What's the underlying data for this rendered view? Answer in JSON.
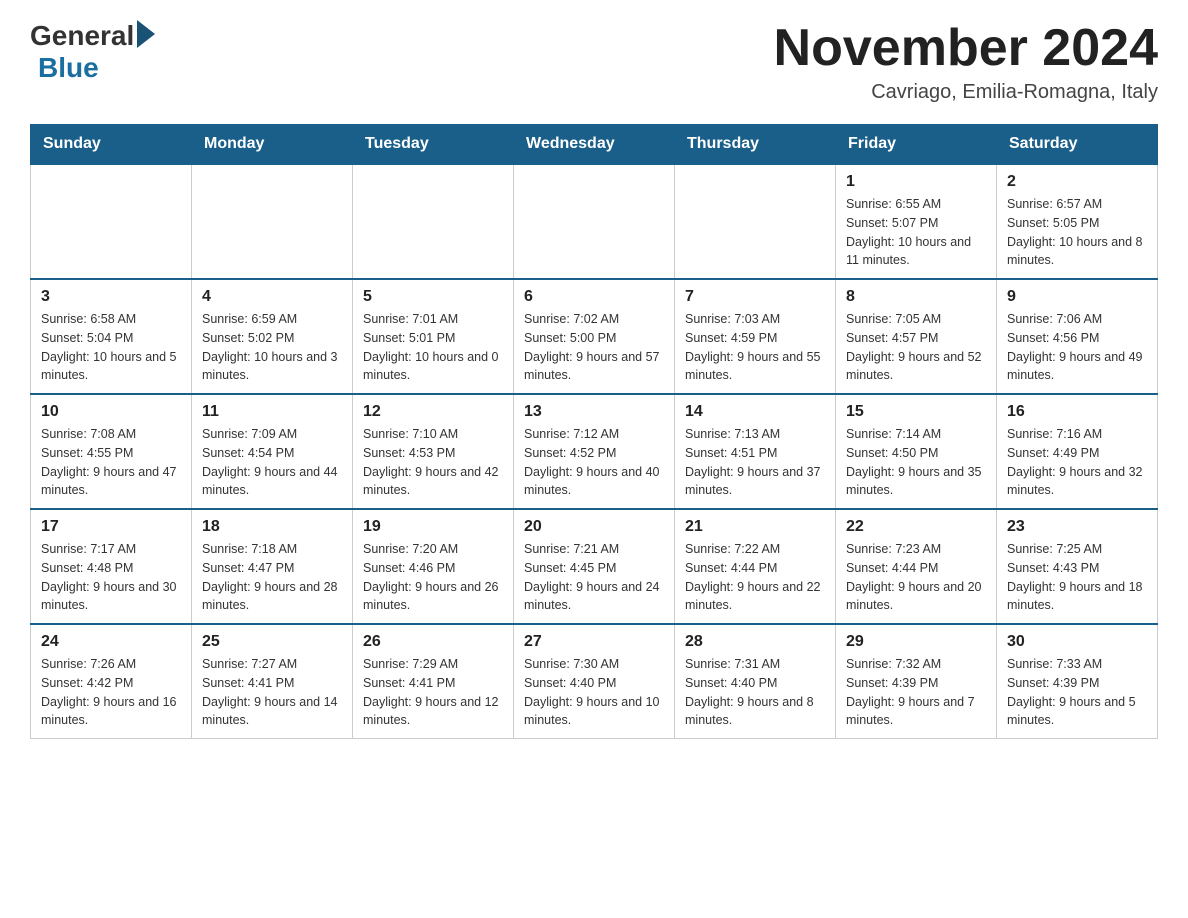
{
  "logo": {
    "general": "General",
    "blue": "Blue"
  },
  "title": "November 2024",
  "location": "Cavriago, Emilia-Romagna, Italy",
  "days_of_week": [
    "Sunday",
    "Monday",
    "Tuesday",
    "Wednesday",
    "Thursday",
    "Friday",
    "Saturday"
  ],
  "weeks": [
    [
      {
        "day": "",
        "info": ""
      },
      {
        "day": "",
        "info": ""
      },
      {
        "day": "",
        "info": ""
      },
      {
        "day": "",
        "info": ""
      },
      {
        "day": "",
        "info": ""
      },
      {
        "day": "1",
        "info": "Sunrise: 6:55 AM\nSunset: 5:07 PM\nDaylight: 10 hours and 11 minutes."
      },
      {
        "day": "2",
        "info": "Sunrise: 6:57 AM\nSunset: 5:05 PM\nDaylight: 10 hours and 8 minutes."
      }
    ],
    [
      {
        "day": "3",
        "info": "Sunrise: 6:58 AM\nSunset: 5:04 PM\nDaylight: 10 hours and 5 minutes."
      },
      {
        "day": "4",
        "info": "Sunrise: 6:59 AM\nSunset: 5:02 PM\nDaylight: 10 hours and 3 minutes."
      },
      {
        "day": "5",
        "info": "Sunrise: 7:01 AM\nSunset: 5:01 PM\nDaylight: 10 hours and 0 minutes."
      },
      {
        "day": "6",
        "info": "Sunrise: 7:02 AM\nSunset: 5:00 PM\nDaylight: 9 hours and 57 minutes."
      },
      {
        "day": "7",
        "info": "Sunrise: 7:03 AM\nSunset: 4:59 PM\nDaylight: 9 hours and 55 minutes."
      },
      {
        "day": "8",
        "info": "Sunrise: 7:05 AM\nSunset: 4:57 PM\nDaylight: 9 hours and 52 minutes."
      },
      {
        "day": "9",
        "info": "Sunrise: 7:06 AM\nSunset: 4:56 PM\nDaylight: 9 hours and 49 minutes."
      }
    ],
    [
      {
        "day": "10",
        "info": "Sunrise: 7:08 AM\nSunset: 4:55 PM\nDaylight: 9 hours and 47 minutes."
      },
      {
        "day": "11",
        "info": "Sunrise: 7:09 AM\nSunset: 4:54 PM\nDaylight: 9 hours and 44 minutes."
      },
      {
        "day": "12",
        "info": "Sunrise: 7:10 AM\nSunset: 4:53 PM\nDaylight: 9 hours and 42 minutes."
      },
      {
        "day": "13",
        "info": "Sunrise: 7:12 AM\nSunset: 4:52 PM\nDaylight: 9 hours and 40 minutes."
      },
      {
        "day": "14",
        "info": "Sunrise: 7:13 AM\nSunset: 4:51 PM\nDaylight: 9 hours and 37 minutes."
      },
      {
        "day": "15",
        "info": "Sunrise: 7:14 AM\nSunset: 4:50 PM\nDaylight: 9 hours and 35 minutes."
      },
      {
        "day": "16",
        "info": "Sunrise: 7:16 AM\nSunset: 4:49 PM\nDaylight: 9 hours and 32 minutes."
      }
    ],
    [
      {
        "day": "17",
        "info": "Sunrise: 7:17 AM\nSunset: 4:48 PM\nDaylight: 9 hours and 30 minutes."
      },
      {
        "day": "18",
        "info": "Sunrise: 7:18 AM\nSunset: 4:47 PM\nDaylight: 9 hours and 28 minutes."
      },
      {
        "day": "19",
        "info": "Sunrise: 7:20 AM\nSunset: 4:46 PM\nDaylight: 9 hours and 26 minutes."
      },
      {
        "day": "20",
        "info": "Sunrise: 7:21 AM\nSunset: 4:45 PM\nDaylight: 9 hours and 24 minutes."
      },
      {
        "day": "21",
        "info": "Sunrise: 7:22 AM\nSunset: 4:44 PM\nDaylight: 9 hours and 22 minutes."
      },
      {
        "day": "22",
        "info": "Sunrise: 7:23 AM\nSunset: 4:44 PM\nDaylight: 9 hours and 20 minutes."
      },
      {
        "day": "23",
        "info": "Sunrise: 7:25 AM\nSunset: 4:43 PM\nDaylight: 9 hours and 18 minutes."
      }
    ],
    [
      {
        "day": "24",
        "info": "Sunrise: 7:26 AM\nSunset: 4:42 PM\nDaylight: 9 hours and 16 minutes."
      },
      {
        "day": "25",
        "info": "Sunrise: 7:27 AM\nSunset: 4:41 PM\nDaylight: 9 hours and 14 minutes."
      },
      {
        "day": "26",
        "info": "Sunrise: 7:29 AM\nSunset: 4:41 PM\nDaylight: 9 hours and 12 minutes."
      },
      {
        "day": "27",
        "info": "Sunrise: 7:30 AM\nSunset: 4:40 PM\nDaylight: 9 hours and 10 minutes."
      },
      {
        "day": "28",
        "info": "Sunrise: 7:31 AM\nSunset: 4:40 PM\nDaylight: 9 hours and 8 minutes."
      },
      {
        "day": "29",
        "info": "Sunrise: 7:32 AM\nSunset: 4:39 PM\nDaylight: 9 hours and 7 minutes."
      },
      {
        "day": "30",
        "info": "Sunrise: 7:33 AM\nSunset: 4:39 PM\nDaylight: 9 hours and 5 minutes."
      }
    ]
  ]
}
